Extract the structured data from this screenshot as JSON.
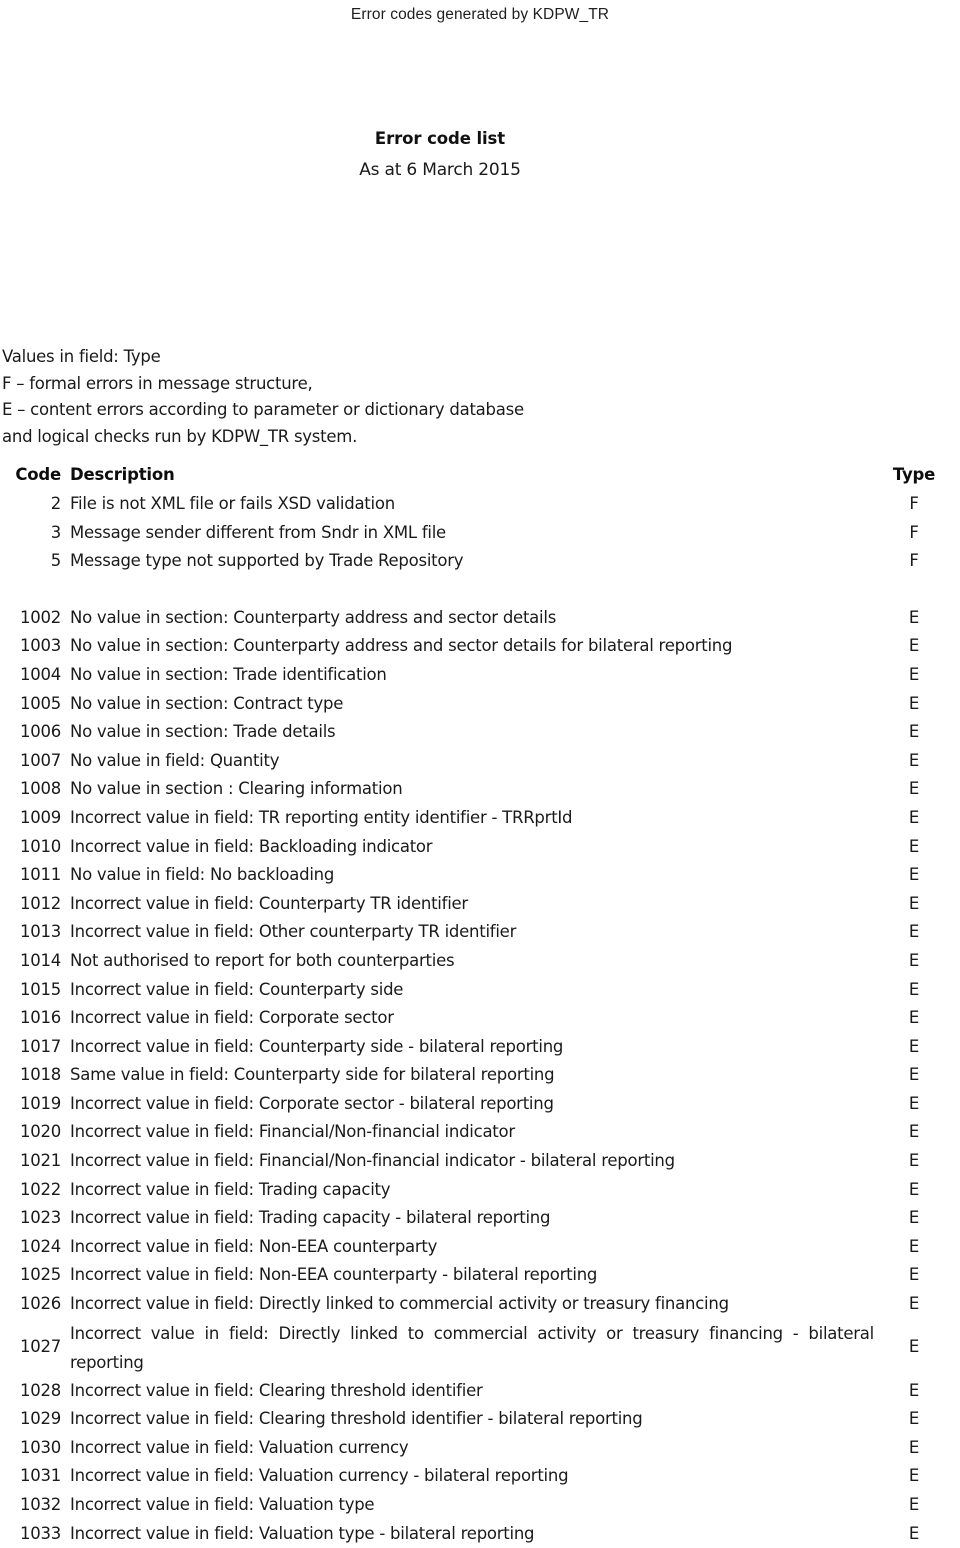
{
  "running_header": "Error codes generated by KDPW_TR",
  "title": {
    "heading": "Error code list",
    "subheading": "As at 6 March 2015"
  },
  "legend": {
    "line1": "Values in field: Type",
    "line2": "F – formal errors in message structure,",
    "line3": "E – content errors according to parameter or dictionary database",
    "line4": "and logical checks run by KDPW_TR system."
  },
  "table": {
    "headers": {
      "code": "Code",
      "description": "Description",
      "type": "Type"
    },
    "group1": [
      {
        "code": "2",
        "description": "File is not XML file or fails XSD validation",
        "type": "F"
      },
      {
        "code": "3",
        "description": "Message sender different from Sndr in XML file",
        "type": "F"
      },
      {
        "code": "5",
        "description": "Message type not supported by Trade Repository",
        "type": "F"
      }
    ],
    "group2": [
      {
        "code": "1002",
        "description": "No value in section: Counterparty address and sector details",
        "type": "E"
      },
      {
        "code": "1003",
        "description": "No value in section: Counterparty address and sector details for bilateral reporting",
        "type": "E"
      },
      {
        "code": "1004",
        "description": "No value in section: Trade identification",
        "type": "E"
      },
      {
        "code": "1005",
        "description": "No value in section: Contract type",
        "type": "E"
      },
      {
        "code": "1006",
        "description": "No value in section: Trade details",
        "type": "E"
      },
      {
        "code": "1007",
        "description": "No value in field: Quantity",
        "type": "E"
      },
      {
        "code": "1008",
        "description": "No value in section : Clearing information",
        "type": "E"
      },
      {
        "code": "1009",
        "description": "Incorrect value in field: TR reporting entity identifier - TRRprtId",
        "type": "E"
      },
      {
        "code": "1010",
        "description": "Incorrect value in field: Backloading indicator",
        "type": "E"
      },
      {
        "code": "1011",
        "description": "No value in field: No backloading",
        "type": "E"
      },
      {
        "code": "1012",
        "description": "Incorrect value in field: Counterparty TR identifier",
        "type": "E"
      },
      {
        "code": "1013",
        "description": "Incorrect value in field: Other counterparty TR identifier",
        "type": "E"
      },
      {
        "code": "1014",
        "description": "Not authorised to report for both counterparties",
        "type": "E"
      },
      {
        "code": "1015",
        "description": "Incorrect value in field: Counterparty side",
        "type": "E"
      },
      {
        "code": "1016",
        "description": "Incorrect value in field: Corporate sector",
        "type": "E"
      },
      {
        "code": "1017",
        "description": "Incorrect value in field: Counterparty side - bilateral reporting",
        "type": "E"
      },
      {
        "code": "1018",
        "description": "Same value in field: Counterparty side for bilateral reporting",
        "type": "E"
      },
      {
        "code": "1019",
        "description": "Incorrect value in field: Corporate sector - bilateral reporting",
        "type": "E"
      },
      {
        "code": "1020",
        "description": "Incorrect value in field: Financial/Non-financial indicator",
        "type": "E"
      },
      {
        "code": "1021",
        "description": "Incorrect value in field: Financial/Non-financial indicator - bilateral reporting",
        "type": "E"
      },
      {
        "code": "1022",
        "description": "Incorrect value in field: Trading capacity",
        "type": "E"
      },
      {
        "code": "1023",
        "description": "Incorrect value in field: Trading capacity - bilateral reporting",
        "type": "E"
      },
      {
        "code": "1024",
        "description": "Incorrect value in field: Non-EEA counterparty",
        "type": "E"
      },
      {
        "code": "1025",
        "description": "Incorrect value in field: Non-EEA counterparty - bilateral reporting",
        "type": "E"
      },
      {
        "code": "1026",
        "description": "Incorrect value in field: Directly linked to commercial activity or treasury financing",
        "type": "E"
      },
      {
        "code": "1027",
        "description": "Incorrect value in field: Directly linked to commercial activity or treasury financing - bilateral reporting",
        "type": "E",
        "wrapped": true
      },
      {
        "code": "1028",
        "description": "Incorrect value in field: Clearing threshold identifier",
        "type": "E"
      },
      {
        "code": "1029",
        "description": "Incorrect value in field: Clearing threshold identifier - bilateral reporting",
        "type": "E"
      },
      {
        "code": "1030",
        "description": "Incorrect value in field: Valuation currency",
        "type": "E"
      },
      {
        "code": "1031",
        "description": "Incorrect value in field: Valuation currency - bilateral reporting",
        "type": "E"
      },
      {
        "code": "1032",
        "description": "Incorrect value in field: Valuation type",
        "type": "E"
      },
      {
        "code": "1033",
        "description": "Incorrect value in field: Valuation type - bilateral reporting",
        "type": "E"
      }
    ]
  }
}
